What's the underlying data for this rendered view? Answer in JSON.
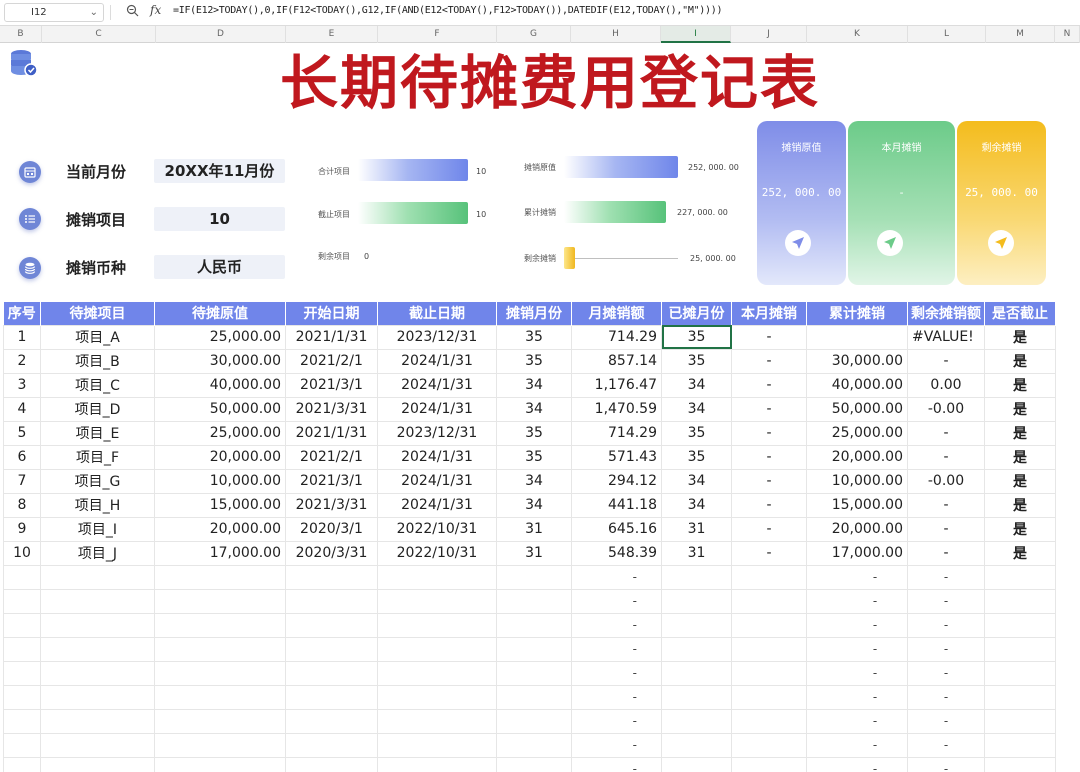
{
  "formula_bar": {
    "cell_ref": "I12",
    "formula": "=IF(E12>TODAY(),0,IF(F12<TODAY(),G12,IF(AND(E12<TODAY(),F12>TODAY()),DATEDIF(E12,TODAY(),\"M\"))))"
  },
  "columns": [
    "B",
    "C",
    "D",
    "E",
    "F",
    "G",
    "H",
    "I",
    "J",
    "K",
    "L",
    "M",
    "N"
  ],
  "active_column": "I",
  "title": "长期待摊费用登记表",
  "info": [
    {
      "label": "当前月份",
      "value": "20XX年11月份",
      "icon": "calendar-icon"
    },
    {
      "label": "摊销项目",
      "value": "10",
      "icon": "list-icon"
    },
    {
      "label": "摊销币种",
      "value": "人民币",
      "icon": "database-icon"
    }
  ],
  "mini_chart_left": {
    "items": [
      {
        "label": "合计项目",
        "value": "10",
        "fraction": 1.0
      },
      {
        "label": "截止项目",
        "value": "10",
        "fraction": 1.0
      },
      {
        "label": "剩余项目",
        "value": "0",
        "fraction": 0
      }
    ]
  },
  "mini_chart_right": {
    "items": [
      {
        "label": "摊销原值",
        "value": "252, 000. 00",
        "fraction": 1.0
      },
      {
        "label": "累计摊销",
        "value": "227, 000. 00",
        "fraction": 0.9
      },
      {
        "label": "剩余摊销",
        "value": "25, 000. 00",
        "fraction": 0.1
      }
    ]
  },
  "cards": [
    {
      "title": "摊销原值",
      "value": "252, 000. 00",
      "icon": "navigation-icon",
      "color": "#7f8de8"
    },
    {
      "title": "本月摊销",
      "value": "-",
      "icon": "navigation-icon",
      "color": "#6ccb89"
    },
    {
      "title": "剩余摊销",
      "value": "25, 000. 00",
      "icon": "navigation-icon",
      "color": "#f4bc1d"
    }
  ],
  "table": {
    "headers": [
      "序号",
      "待摊项目",
      "待摊原值",
      "开始日期",
      "截止日期",
      "摊销月份",
      "月摊销额",
      "已摊月份",
      "本月摊销",
      "累计摊销",
      "剩余摊销额",
      "是否截止"
    ],
    "rows": [
      [
        "1",
        "项目_A",
        "25,000.00",
        "2021/1/31",
        "2023/12/31",
        "35",
        "714.29",
        "35",
        "-",
        "",
        "#VALUE!",
        "是"
      ],
      [
        "2",
        "项目_B",
        "30,000.00",
        "2021/2/1",
        "2024/1/31",
        "35",
        "857.14",
        "35",
        "-",
        "30,000.00",
        "-",
        "是"
      ],
      [
        "3",
        "项目_C",
        "40,000.00",
        "2021/3/1",
        "2024/1/31",
        "34",
        "1,176.47",
        "34",
        "-",
        "40,000.00",
        "0.00",
        "是"
      ],
      [
        "4",
        "项目_D",
        "50,000.00",
        "2021/3/31",
        "2024/1/31",
        "34",
        "1,470.59",
        "34",
        "-",
        "50,000.00",
        "-0.00",
        "是"
      ],
      [
        "5",
        "项目_E",
        "25,000.00",
        "2021/1/31",
        "2023/12/31",
        "35",
        "714.29",
        "35",
        "-",
        "25,000.00",
        "-",
        "是"
      ],
      [
        "6",
        "项目_F",
        "20,000.00",
        "2021/2/1",
        "2024/1/31",
        "35",
        "571.43",
        "35",
        "-",
        "20,000.00",
        "-",
        "是"
      ],
      [
        "7",
        "项目_G",
        "10,000.00",
        "2021/3/1",
        "2024/1/31",
        "34",
        "294.12",
        "34",
        "-",
        "10,000.00",
        "-0.00",
        "是"
      ],
      [
        "8",
        "项目_H",
        "15,000.00",
        "2021/3/31",
        "2024/1/31",
        "34",
        "441.18",
        "34",
        "-",
        "15,000.00",
        "-",
        "是"
      ],
      [
        "9",
        "项目_I",
        "20,000.00",
        "2020/3/1",
        "2022/10/31",
        "31",
        "645.16",
        "31",
        "-",
        "20,000.00",
        "-",
        "是"
      ],
      [
        "10",
        "项目_J",
        "17,000.00",
        "2020/3/31",
        "2022/10/31",
        "31",
        "548.39",
        "31",
        "-",
        "17,000.00",
        "-",
        "是"
      ]
    ],
    "empty_rows": 9,
    "empty_dash": "-"
  },
  "colors": {
    "title": "#c0181e",
    "table_header": "#7085ea",
    "selection": "#217346"
  }
}
